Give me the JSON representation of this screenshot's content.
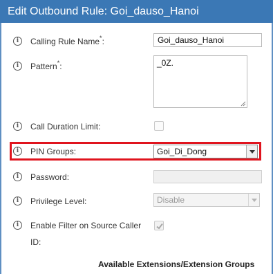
{
  "dialog": {
    "title": "Edit Outbound Rule: Goi_dauso_Hanoi",
    "colors": {
      "title_bar": "#3b78b5",
      "highlight": "#e0141e"
    }
  },
  "fields": {
    "calling_rule_name": {
      "label": "Calling Rule Name",
      "required_mark": "*",
      "suffix": ":",
      "value": "Goi_dauso_Hanoi"
    },
    "pattern": {
      "label": "Pattern",
      "required_mark": "*",
      "suffix": ":",
      "value": "_0Z."
    },
    "call_duration_limit": {
      "label": "Call Duration Limit:",
      "checked": false
    },
    "pin_groups": {
      "label": "PIN Groups:",
      "selected": "Goi_Di_Dong"
    },
    "password": {
      "label": "Password:",
      "value": ""
    },
    "privilege_level": {
      "label": "Privilege Level:",
      "selected": "Disable"
    },
    "enable_filter": {
      "label_line1": "Enable Filter on Source Caller",
      "label_line2": "ID:",
      "checked": true
    }
  },
  "section": {
    "heading": "Available Extensions/Extension Groups"
  },
  "icons": {
    "info": "info-circle-icon",
    "info_glyph": "i"
  }
}
